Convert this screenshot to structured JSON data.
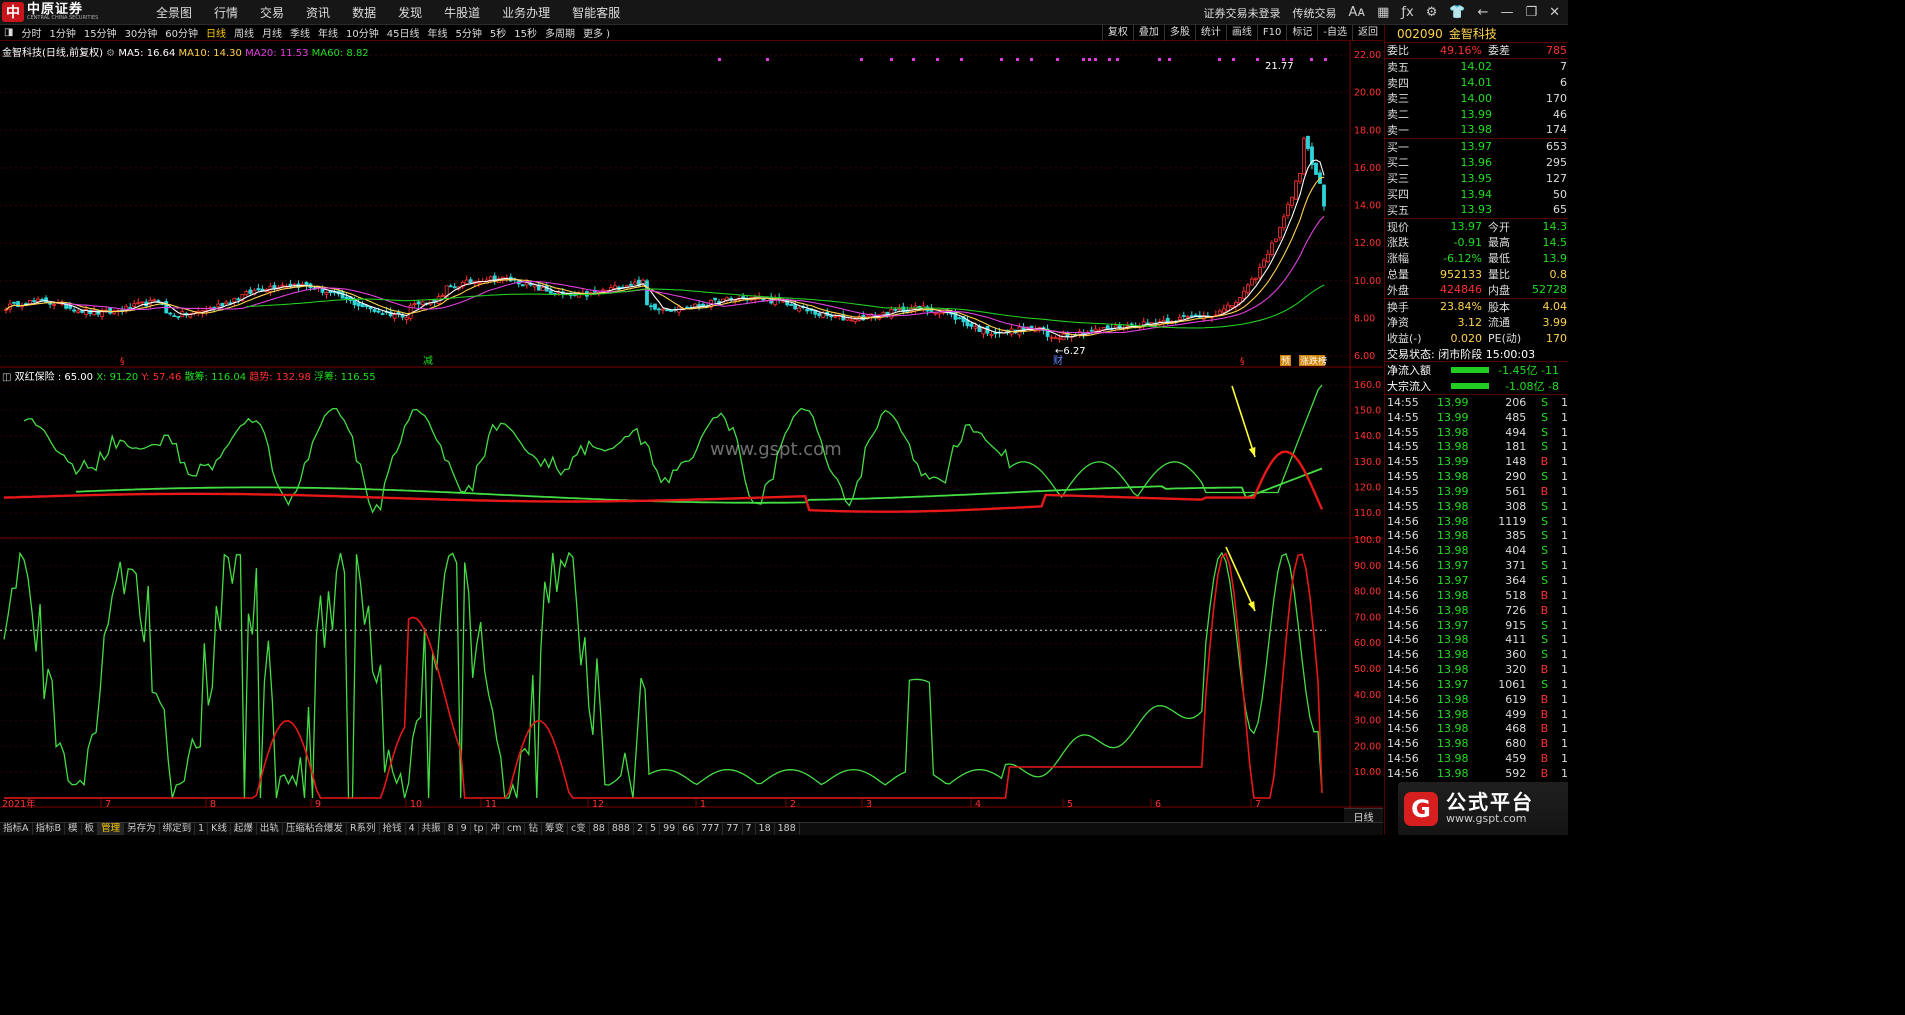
{
  "app": {
    "logo_cn": "中原证券",
    "logo_en": "CENTRAL CHINA SECURITIES",
    "menu": [
      "全景图",
      "行情",
      "交易",
      "资讯",
      "数据",
      "发现",
      "牛股道",
      "业务办理",
      "智能客服"
    ],
    "top_right": {
      "login_status": "证券交易未登录",
      "mode": "传统交易"
    }
  },
  "period_bar": {
    "items": [
      "分时",
      "1分钟",
      "15分钟",
      "30分钟",
      "60分钟",
      "日线",
      "周线",
      "月线",
      "季线",
      "年线",
      "10分钟",
      "45日线",
      "年线",
      "5分钟",
      "5秒",
      "15秒",
      "多周期",
      "更多 )"
    ],
    "active_index": 5,
    "tools": [
      "复权",
      "叠加",
      "多股",
      "统计",
      "画线",
      "F10",
      "标记",
      "-自选",
      "返回"
    ]
  },
  "main_legend": {
    "stock": "金智科技(日线,前复权)",
    "ma5": "MA5: 16.64",
    "ma10": "MA10: 14.30",
    "ma20": "MA20: 11.53",
    "ma60": "MA60: 8.82"
  },
  "ind1_legend": {
    "name": "双红保险 : 65.00",
    "x": "X: 91.20",
    "y": "Y: 57.46",
    "sanchou": "散筹: 116.04",
    "qushi": "趋势: 132.98",
    "fuchou": "浮筹: 116.55"
  },
  "chart_annotations": {
    "high": "21.77",
    "low": "6.27",
    "year_label": "2021年",
    "period_label": "日线",
    "tag_jian": "减",
    "tag_cai": "财",
    "tag_yu": "预",
    "tag_zhangting": "涨跌榜"
  },
  "axes": {
    "main": [
      "22.00",
      "20.00",
      "18.00",
      "16.00",
      "14.00",
      "12.00",
      "10.00",
      "8.00",
      "6.00"
    ],
    "ind1": [
      "160.0",
      "150.0",
      "140.0",
      "130.0",
      "120.0",
      "110.0"
    ],
    "ind2": [
      "100.0",
      "90.00",
      "80.00",
      "70.00",
      "60.00",
      "50.00",
      "40.00",
      "30.00",
      "20.00",
      "10.00"
    ],
    "months": [
      "7",
      "8",
      "9",
      "10",
      "11",
      "12",
      "1",
      "2",
      "3",
      "4",
      "5",
      "6",
      "7"
    ]
  },
  "quote": {
    "code": "002090",
    "name": "金智科技",
    "weibi_label": "委比",
    "weibi": "49.16%",
    "weicha_label": "委差",
    "weicha": "785",
    "sell": [
      {
        "label": "卖五",
        "price": "14.02",
        "vol": "7"
      },
      {
        "label": "卖四",
        "price": "14.01",
        "vol": "6"
      },
      {
        "label": "卖三",
        "price": "14.00",
        "vol": "170"
      },
      {
        "label": "卖二",
        "price": "13.99",
        "vol": "46"
      },
      {
        "label": "卖一",
        "price": "13.98",
        "vol": "174"
      }
    ],
    "buy": [
      {
        "label": "买一",
        "price": "13.97",
        "vol": "653"
      },
      {
        "label": "买二",
        "price": "13.96",
        "vol": "295"
      },
      {
        "label": "买三",
        "price": "13.95",
        "vol": "127"
      },
      {
        "label": "买四",
        "price": "13.94",
        "vol": "50"
      },
      {
        "label": "买五",
        "price": "13.93",
        "vol": "65"
      }
    ],
    "stats": [
      {
        "l1": "现价",
        "v1": "13.97",
        "l2": "今开",
        "v2": "14.3"
      },
      {
        "l1": "涨跌",
        "v1": "-0.91",
        "l2": "最高",
        "v2": "14.5"
      },
      {
        "l1": "涨幅",
        "v1": "-6.12%",
        "l2": "最低",
        "v2": "13.9"
      },
      {
        "l1": "总量",
        "v1": "952133",
        "l2": "量比",
        "v2": "0.8"
      },
      {
        "l1": "外盘",
        "v1": "424846",
        "l2": "内盘",
        "v2": "52728"
      }
    ],
    "stats2": [
      {
        "l1": "换手",
        "v1": "23.84%",
        "l2": "股本",
        "v2": "4.04"
      },
      {
        "l1": "净资",
        "v1": "3.12",
        "l2": "流通",
        "v2": "3.99"
      },
      {
        "l1": "收益(-)",
        "v1": "0.020",
        "l2": "PE(动)",
        "v2": "170"
      }
    ],
    "trade_status": "交易状态: 闭市阶段 15:00:03",
    "flows": [
      {
        "label": "净流入额",
        "value": "-1.45亿 -11"
      },
      {
        "label": "大宗流入",
        "value": "-1.08亿 -8"
      }
    ]
  },
  "ticks": [
    {
      "t": "14:55",
      "p": "13.99",
      "v": "206",
      "d": "S",
      "x": "1"
    },
    {
      "t": "14:55",
      "p": "13.99",
      "v": "485",
      "d": "S",
      "x": "1"
    },
    {
      "t": "14:55",
      "p": "13.98",
      "v": "494",
      "d": "S",
      "x": "1"
    },
    {
      "t": "14:55",
      "p": "13.98",
      "v": "181",
      "d": "S",
      "x": "1"
    },
    {
      "t": "14:55",
      "p": "13.99",
      "v": "148",
      "d": "B",
      "x": "1"
    },
    {
      "t": "14:55",
      "p": "13.98",
      "v": "290",
      "d": "S",
      "x": "1"
    },
    {
      "t": "14:55",
      "p": "13.99",
      "v": "561",
      "d": "B",
      "x": "1"
    },
    {
      "t": "14:55",
      "p": "13.98",
      "v": "308",
      "d": "S",
      "x": "1"
    },
    {
      "t": "14:56",
      "p": "13.98",
      "v": "1119",
      "d": "S",
      "x": "1"
    },
    {
      "t": "14:56",
      "p": "13.98",
      "v": "385",
      "d": "S",
      "x": "1"
    },
    {
      "t": "14:56",
      "p": "13.98",
      "v": "404",
      "d": "S",
      "x": "1"
    },
    {
      "t": "14:56",
      "p": "13.97",
      "v": "371",
      "d": "S",
      "x": "1"
    },
    {
      "t": "14:56",
      "p": "13.97",
      "v": "364",
      "d": "S",
      "x": "1"
    },
    {
      "t": "14:56",
      "p": "13.98",
      "v": "518",
      "d": "B",
      "x": "1"
    },
    {
      "t": "14:56",
      "p": "13.98",
      "v": "726",
      "d": "B",
      "x": "1"
    },
    {
      "t": "14:56",
      "p": "13.97",
      "v": "915",
      "d": "S",
      "x": "1"
    },
    {
      "t": "14:56",
      "p": "13.98",
      "v": "411",
      "d": "S",
      "x": "1"
    },
    {
      "t": "14:56",
      "p": "13.98",
      "v": "360",
      "d": "S",
      "x": "1"
    },
    {
      "t": "14:56",
      "p": "13.98",
      "v": "320",
      "d": "B",
      "x": "1"
    },
    {
      "t": "14:56",
      "p": "13.97",
      "v": "1061",
      "d": "S",
      "x": "1"
    },
    {
      "t": "14:56",
      "p": "13.98",
      "v": "619",
      "d": "B",
      "x": "1"
    },
    {
      "t": "14:56",
      "p": "13.98",
      "v": "499",
      "d": "B",
      "x": "1"
    },
    {
      "t": "14:56",
      "p": "13.98",
      "v": "468",
      "d": "B",
      "x": "1"
    },
    {
      "t": "14:56",
      "p": "13.98",
      "v": "680",
      "d": "B",
      "x": "1"
    },
    {
      "t": "14:56",
      "p": "13.98",
      "v": "459",
      "d": "B",
      "x": "1"
    },
    {
      "t": "14:56",
      "p": "13.98",
      "v": "592",
      "d": "B",
      "x": "1"
    }
  ],
  "bottom_bar": [
    "指标A",
    "指标B",
    "模",
    "板",
    "管理",
    "另存为",
    "绑定到",
    "1",
    "K线",
    "起爆",
    "出轨",
    "压缩粘合爆发",
    "R系列",
    "抢钱",
    "4",
    "共振",
    "8",
    "9",
    "tp",
    "冲",
    "cm",
    "钻",
    "筹变",
    "c变",
    "88",
    "888",
    "2",
    "5",
    "99",
    "66",
    "777",
    "77",
    "7",
    "18",
    "188"
  ],
  "bottom_selected": 4,
  "watermark": "www.gspt.com",
  "badge": {
    "title": "公式平台",
    "url": "www.gspt.com"
  },
  "colors": {
    "up": "#ff3030",
    "down": "#22dd22",
    "ma5": "#ffffff",
    "ma10": "#ffd24d",
    "ma20": "#e040e0",
    "ma60": "#22cc22",
    "accent": "#ffd24d"
  }
}
